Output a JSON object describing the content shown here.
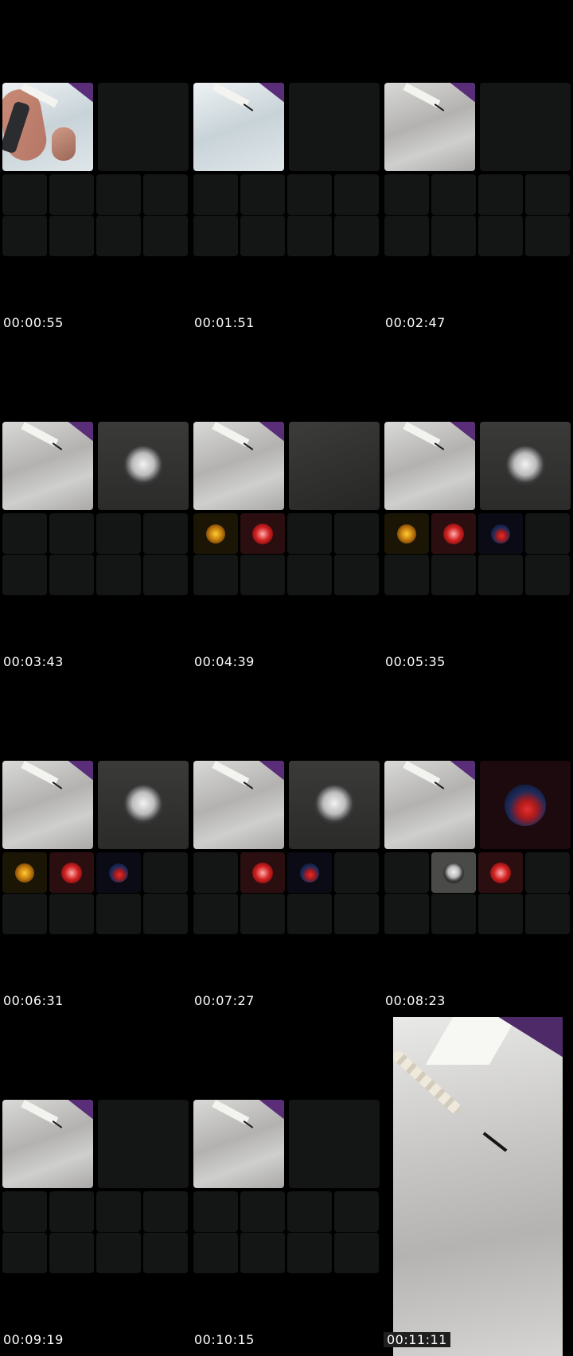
{
  "frames": [
    {
      "timestamp": "00:00:55"
    },
    {
      "timestamp": "00:01:51"
    },
    {
      "timestamp": "00:02:47"
    },
    {
      "timestamp": "00:03:43"
    },
    {
      "timestamp": "00:04:39"
    },
    {
      "timestamp": "00:05:35"
    },
    {
      "timestamp": "00:06:31"
    },
    {
      "timestamp": "00:07:27"
    },
    {
      "timestamp": "00:08:23"
    },
    {
      "timestamp": "00:09:19"
    },
    {
      "timestamp": "00:10:15"
    },
    {
      "timestamp": "00:11:11"
    }
  ],
  "colors": {
    "background": "#000000",
    "empty_tile": "#141515",
    "accent_purple": "#5a2d78"
  },
  "icons": [
    "camera-feed-tile",
    "avatar-white-player",
    "avatar-gold",
    "avatar-red",
    "avatar-blue-red"
  ]
}
